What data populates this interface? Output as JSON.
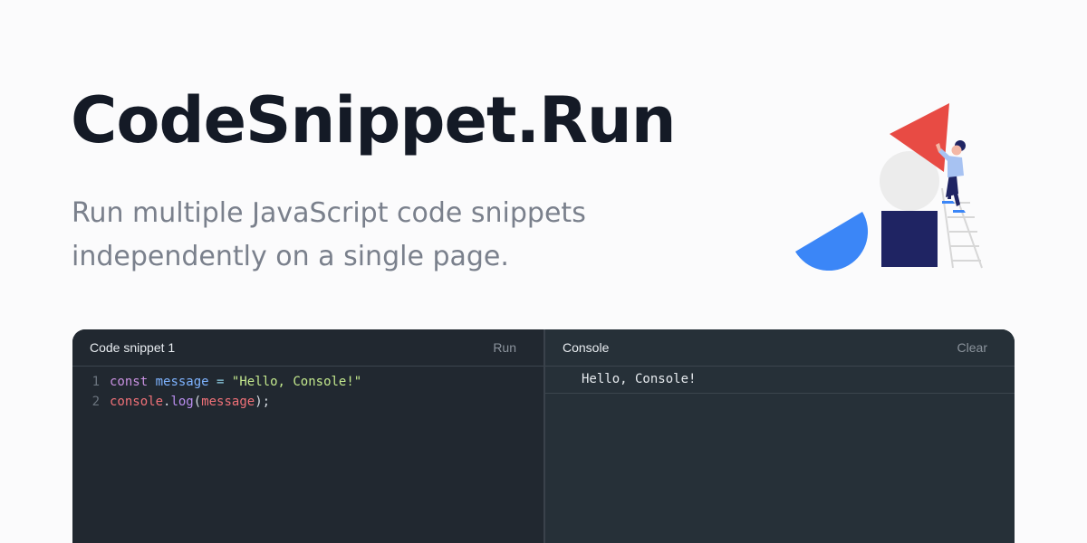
{
  "header": {
    "title": "CodeSnippet.Run",
    "subtitle_line1": "Run multiple JavaScript code snippets",
    "subtitle_line2": "independently on a single page."
  },
  "illustration": {
    "icon": "person-stacking-shapes-illustration",
    "colors": {
      "triangle": "#e84b44",
      "circle": "#ececec",
      "square": "#1f2463",
      "half_circle": "#3b86f7",
      "ladder": "#d7d7d7"
    }
  },
  "code_pane": {
    "title": "Code snippet 1",
    "run_label": "Run",
    "lines": [
      {
        "number": "1",
        "tokens": {
          "kw": "const",
          "sp1": " ",
          "var": "message",
          "sp2": " ",
          "op": "=",
          "sp3": " ",
          "str": "\"Hello, Console!\""
        }
      },
      {
        "number": "2",
        "tokens": {
          "obj": "console",
          "dot": ".",
          "fn": "log",
          "open": "(",
          "arg": "message",
          "close": ");"
        }
      }
    ]
  },
  "console_pane": {
    "title": "Console",
    "clear_label": "Clear",
    "output": [
      "Hello, Console!"
    ]
  },
  "colors": {
    "page_background": "#fbfbfc",
    "title": "#141a26",
    "subtitle": "#7a808c",
    "editor_background": "#212830",
    "console_background": "#263038"
  }
}
